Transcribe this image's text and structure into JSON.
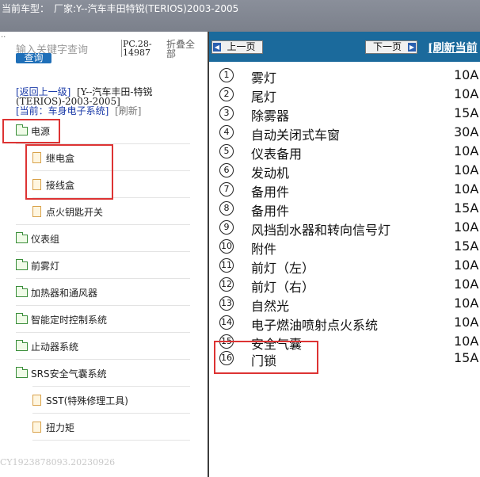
{
  "header": {
    "label": "当前车型：",
    "model": "厂家:Y--汽车丰田特锐(TERIOS)2003-2005"
  },
  "left": {
    "search_placeholder": "输入关键字查询",
    "search_button": "查询",
    "pc_line1": "PC.28-",
    "pc_line2": "14987",
    "collapse_line1": "折叠全",
    "collapse_line2": "部",
    "nav_back": "[返回上一级]",
    "nav_path1": "[Y--汽车丰田-特锐",
    "nav_path2": "(TERIOS)-2003-2005]",
    "nav_current": "[当前：车身电子系统]",
    "nav_refresh": "[刷新]",
    "tree": [
      {
        "label": "电源",
        "type": "folder"
      },
      {
        "label": "继电盒",
        "type": "doc"
      },
      {
        "label": "接线盒",
        "type": "doc"
      },
      {
        "label": "点火钥匙开关",
        "type": "doc"
      },
      {
        "label": "仪表组",
        "type": "folder"
      },
      {
        "label": "前雾灯",
        "type": "folder"
      },
      {
        "label": "加热器和通风器",
        "type": "folder"
      },
      {
        "label": "智能定时控制系统",
        "type": "folder"
      },
      {
        "label": "止动器系统",
        "type": "folder"
      },
      {
        "label": "SRS安全气囊系统",
        "type": "folder"
      },
      {
        "label": "SST(特殊修理工具)",
        "type": "doc"
      },
      {
        "label": "扭力矩",
        "type": "doc"
      }
    ],
    "watermark": "CY1923878093.20230926"
  },
  "right": {
    "prev_label": "上一页",
    "next_label": "下一页",
    "refresh_label": "[刷新当前",
    "fuses": [
      {
        "num": "1",
        "name": "雾灯",
        "amp": "10A"
      },
      {
        "num": "2",
        "name": "尾灯",
        "amp": "10A"
      },
      {
        "num": "3",
        "name": "除雾器",
        "amp": "15A"
      },
      {
        "num": "4",
        "name": "自动关闭式车窗",
        "amp": "30A"
      },
      {
        "num": "5",
        "name": "仪表备用",
        "amp": "10A"
      },
      {
        "num": "6",
        "name": "发动机",
        "amp": "10A"
      },
      {
        "num": "7",
        "name": "备用件",
        "amp": "10A"
      },
      {
        "num": "8",
        "name": "备用件",
        "amp": "15A"
      },
      {
        "num": "9",
        "name": "风挡刮水器和转向信号灯",
        "amp": "10A"
      },
      {
        "num": "10",
        "name": "附件",
        "amp": "15A"
      },
      {
        "num": "11",
        "name": "前灯（左）",
        "amp": "10A"
      },
      {
        "num": "12",
        "name": "前灯（右）",
        "amp": "10A"
      },
      {
        "num": "13",
        "name": "自然光",
        "amp": "10A"
      },
      {
        "num": "14",
        "name": "电子燃油喷射点火系统",
        "amp": "10A"
      },
      {
        "num": "15",
        "name": "安全气囊",
        "amp": "10A"
      },
      {
        "num": "16",
        "name": "门锁",
        "amp": "15A"
      }
    ]
  },
  "colors": {
    "highlight": "#d33333",
    "toolbar": "#1b6a9c",
    "link": "#1a3aa8"
  }
}
